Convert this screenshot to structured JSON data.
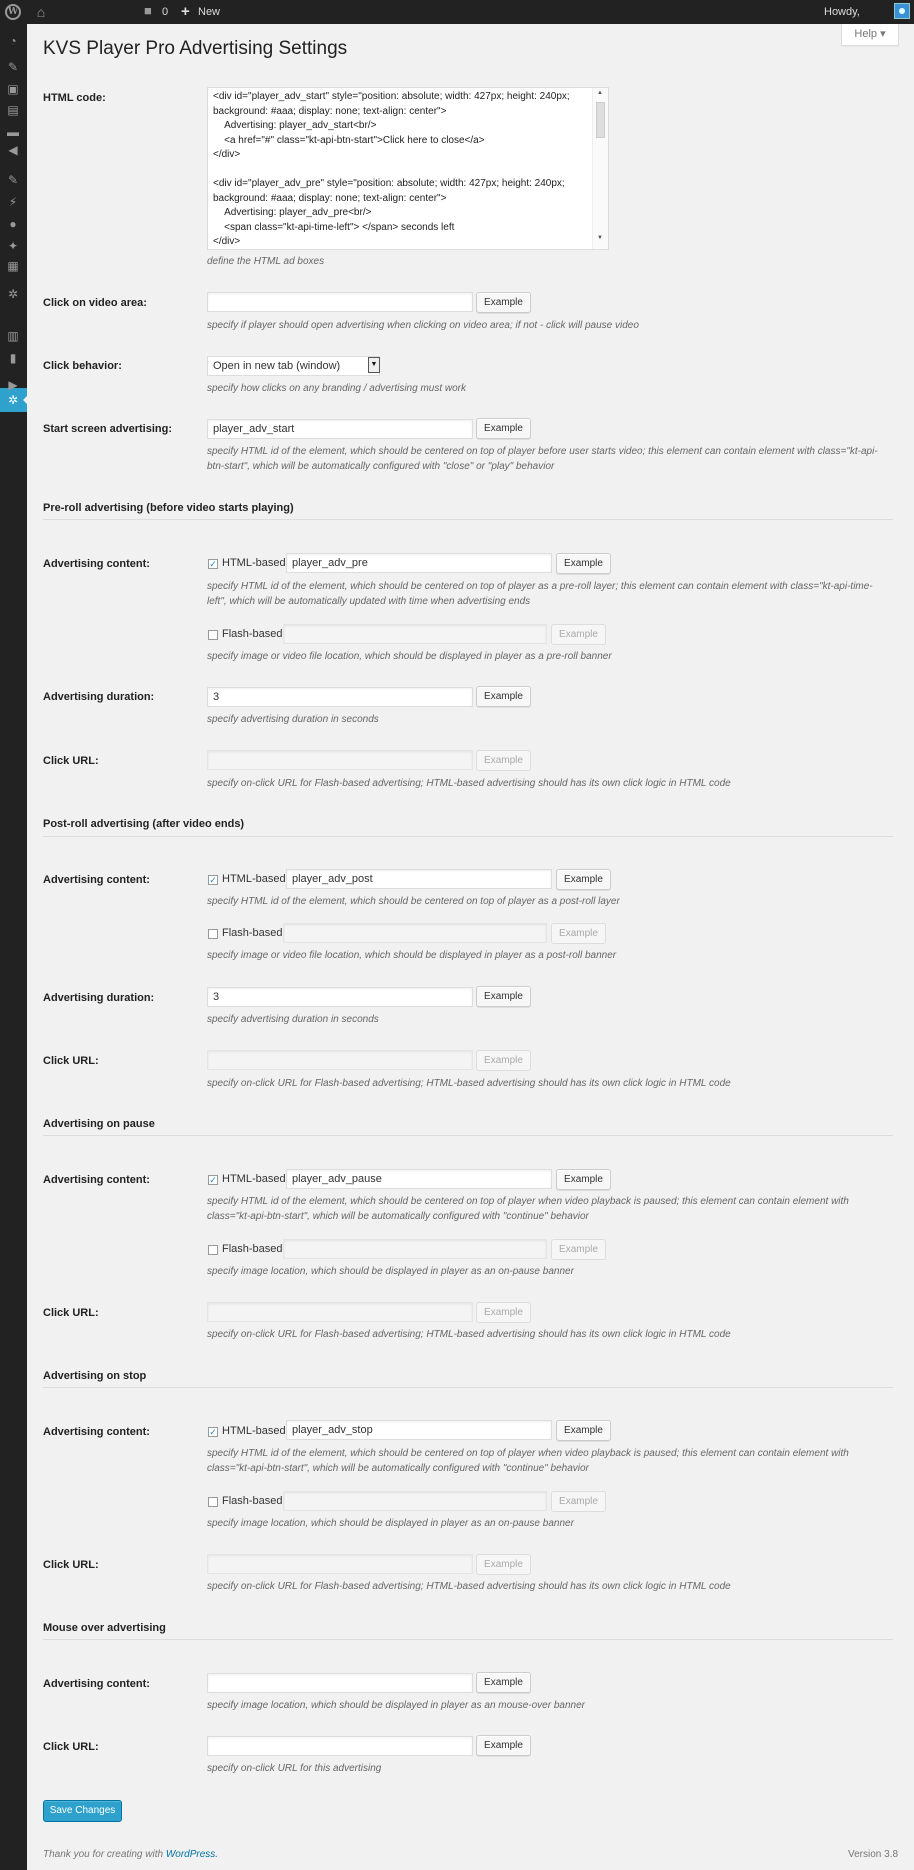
{
  "adminbar": {
    "comment_count": "0",
    "new_label": "New",
    "howdy": "Howdy,"
  },
  "help_tab": "Help ▾",
  "page_title": "KVS Player Pro Advertising Settings",
  "html_code": {
    "label": "HTML code:",
    "value": "<div id=\"player_adv_start\" style=\"position: absolute; width: 427px; height: 240px; background: #aaa; display: none; text-align: center\">\n    Advertising: player_adv_start<br/>\n    <a href=\"#\" class=\"kt-api-btn-start\">Click here to close</a>\n</div>\n\n<div id=\"player_adv_pre\" style=\"position: absolute; width: 427px; height: 240px; background: #aaa; display: none; text-align: center\">\n    Advertising: player_adv_pre<br/>\n    <span class=\"kt-api-time-left\"> </span> seconds left\n</div>",
    "desc": "define the HTML ad boxes"
  },
  "click_video_area": {
    "label": "Click on video area:",
    "value": "",
    "button": "Example",
    "desc": "specify if player should open advertising when clicking on video area; if not - click will pause video"
  },
  "click_behavior": {
    "label": "Click behavior:",
    "selected": "Open in new tab (window)",
    "desc": "specify how clicks on any branding / advertising must work"
  },
  "start_screen": {
    "label": "Start screen advertising:",
    "value": "player_adv_start",
    "button": "Example",
    "desc": "specify HTML id of the element, which should be centered on top of player before user starts video; this element can contain element with class=\"kt-api-btn-start\", which will be automatically configured with \"close\" or \"play\" behavior"
  },
  "preroll": {
    "title": "Pre-roll advertising (before video starts playing)",
    "content_label": "Advertising content:",
    "html_based_label": "HTML-based",
    "html_value": "player_adv_pre",
    "html_button": "Example",
    "html_desc": "specify HTML id of the element, which should be centered on top of player as a pre-roll layer; this element can contain element with class=\"kt-api-time-left\", which will be automatically updated with time when advertising ends",
    "flash_label": "Flash-based",
    "flash_value": "",
    "flash_button": "Example",
    "flash_desc": "specify image or video file location, which should be displayed in player as a pre-roll banner",
    "duration_label": "Advertising duration:",
    "duration_value": "3",
    "duration_button": "Example",
    "duration_desc": "specify advertising duration in seconds",
    "url_label": "Click URL:",
    "url_value": "",
    "url_button": "Example",
    "url_desc": "specify on-click URL for Flash-based advertising; HTML-based advertising should has its own click logic in HTML code"
  },
  "postroll": {
    "title": "Post-roll advertising (after video ends)",
    "content_label": "Advertising content:",
    "html_based_label": "HTML-based",
    "html_value": "player_adv_post",
    "html_button": "Example",
    "html_desc": "specify HTML id of the element, which should be centered on top of player as a post-roll layer",
    "flash_label": "Flash-based",
    "flash_value": "",
    "flash_button": "Example",
    "flash_desc": "specify image or video file location, which should be displayed in player as a post-roll banner",
    "duration_label": "Advertising duration:",
    "duration_value": "3",
    "duration_button": "Example",
    "duration_desc": "specify advertising duration in seconds",
    "url_label": "Click URL:",
    "url_value": "",
    "url_button": "Example",
    "url_desc": "specify on-click URL for Flash-based advertising; HTML-based advertising should has its own click logic in HTML code"
  },
  "pause": {
    "title": "Advertising on pause",
    "content_label": "Advertising content:",
    "html_based_label": "HTML-based",
    "html_value": "player_adv_pause",
    "html_button": "Example",
    "html_desc": "specify HTML id of the element, which should be centered on top of player when video playback is paused; this element can contain element with class=\"kt-api-btn-start\", which will be automatically configured with \"continue\" behavior",
    "flash_label": "Flash-based",
    "flash_value": "",
    "flash_button": "Example",
    "flash_desc": "specify image location, which should be displayed in player as an on-pause banner",
    "url_label": "Click URL:",
    "url_value": "",
    "url_button": "Example",
    "url_desc": "specify on-click URL for Flash-based advertising; HTML-based advertising should has its own click logic in HTML code"
  },
  "stop": {
    "title": "Advertising on stop",
    "content_label": "Advertising content:",
    "html_based_label": "HTML-based",
    "html_value": "player_adv_stop",
    "html_button": "Example",
    "html_desc": "specify HTML id of the element, which should be centered on top of player when video playback is paused; this element can contain element with class=\"kt-api-btn-start\", which will be automatically configured with \"continue\" behavior",
    "flash_label": "Flash-based",
    "flash_value": "",
    "flash_button": "Example",
    "flash_desc": "specify image location, which should be displayed in player as an on-pause banner",
    "url_label": "Click URL:",
    "url_value": "",
    "url_button": "Example",
    "url_desc": "specify on-click URL for Flash-based advertising; HTML-based advertising should has its own click logic in HTML code"
  },
  "mouseover": {
    "title": "Mouse over advertising",
    "content_label": "Advertising content:",
    "content_value": "",
    "content_button": "Example",
    "content_desc": "specify image location, which should be displayed in player as an mouse-over banner",
    "url_label": "Click URL:",
    "url_value": "",
    "url_button": "Example",
    "url_desc": "specify on-click URL for this advertising"
  },
  "save_button": "Save Changes",
  "footer": {
    "thanks": "Thank you for creating with",
    "link": "WordPress.",
    "version": "Version 3.8"
  },
  "colors": {
    "accent": "#2ea2cc",
    "adminbar": "#222222",
    "background": "#f1f1f1"
  },
  "icons": {
    "logo": "wordpress-logo-icon",
    "home": "home-icon",
    "comments": "comment-bubble-icon",
    "new": "plus-icon",
    "current_menu": "gear-icon"
  }
}
